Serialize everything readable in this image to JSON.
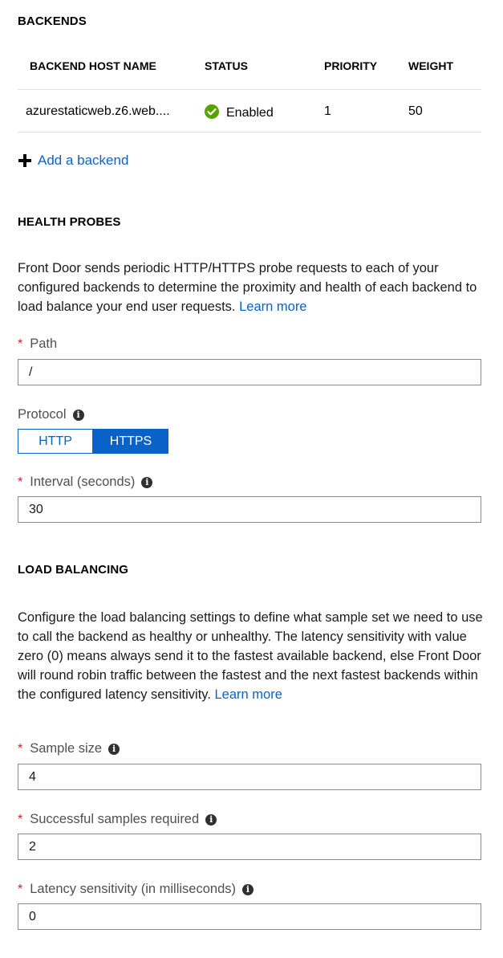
{
  "backends": {
    "title": "BACKENDS",
    "columns": {
      "host": "BACKEND HOST NAME",
      "status": "STATUS",
      "priority": "PRIORITY",
      "weight": "WEIGHT"
    },
    "rows": [
      {
        "host": "azurestaticweb.z6.web....",
        "status": "Enabled",
        "priority": "1",
        "weight": "50"
      }
    ],
    "add_label": "Add a backend"
  },
  "health_probes": {
    "title": "HEALTH PROBES",
    "description": "Front Door sends periodic HTTP/HTTPS probe requests to each of your configured backends to determine the proximity and health of each backend to load balance your end user requests.",
    "learn_more": "Learn more",
    "path": {
      "label": "Path",
      "value": "/"
    },
    "protocol": {
      "label": "Protocol",
      "options": [
        "HTTP",
        "HTTPS"
      ],
      "selected": "HTTPS"
    },
    "interval": {
      "label": "Interval (seconds)",
      "value": "30"
    }
  },
  "load_balancing": {
    "title": "LOAD BALANCING",
    "description": "Configure the load balancing settings to define what sample set we need to use to call the backend as healthy or unhealthy. The latency sensitivity with value zero (0) means always send it to the fastest available backend, else Front Door will round robin traffic between the fastest and the next fastest backends within the configured latency sensitivity.",
    "learn_more": "Learn more",
    "sample_size": {
      "label": "Sample size",
      "value": "4"
    },
    "successful_samples": {
      "label": "Successful samples required",
      "value": "2"
    },
    "latency": {
      "label": "Latency sensitivity (in milliseconds)",
      "value": "0"
    }
  },
  "colors": {
    "accent": "#0a62c9",
    "required": "#c4262e",
    "enabled": "#57a300",
    "border": "#8a8a8a"
  }
}
